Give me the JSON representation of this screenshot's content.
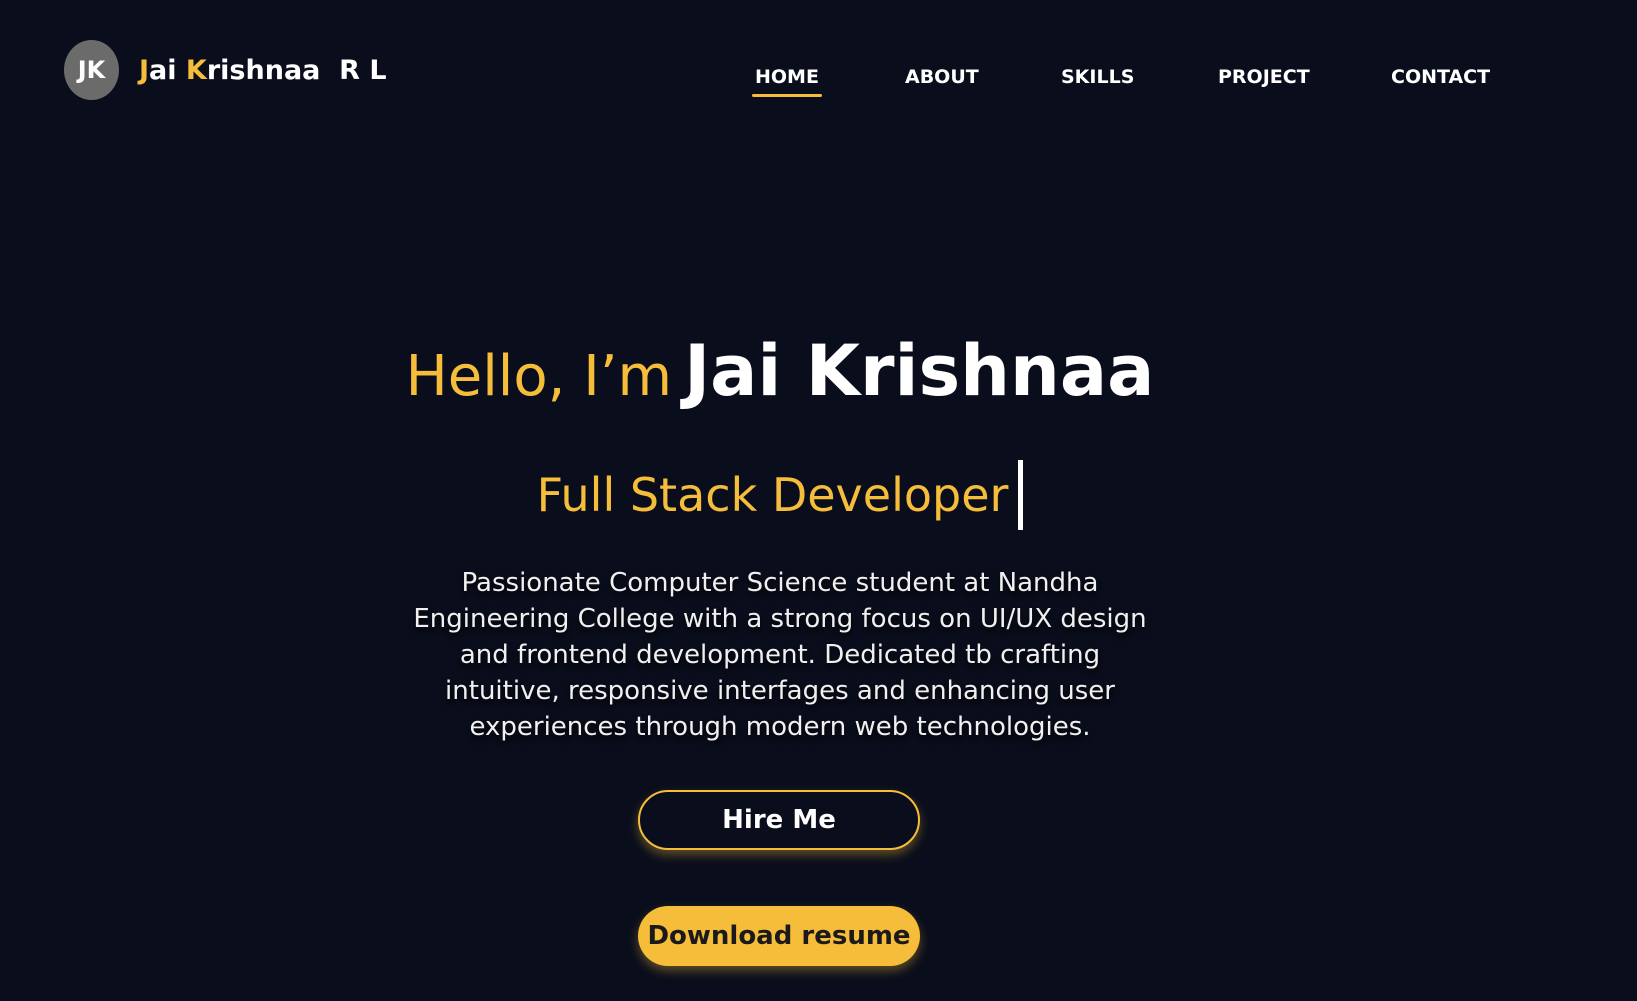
{
  "header": {
    "avatar_initials": "JK",
    "brand": {
      "first_initial": "J",
      "first_rest": "ai ",
      "second_initial": "K",
      "second_rest": "rishnaa  R L"
    },
    "nav": [
      {
        "label": "HOME",
        "active": true
      },
      {
        "label": "ABOUT",
        "active": false
      },
      {
        "label": "SKILLS",
        "active": false
      },
      {
        "label": "PROJECT",
        "active": false
      },
      {
        "label": "CONTACT",
        "active": false
      }
    ]
  },
  "hero": {
    "greeting": "Hello, I’m",
    "name": "Jai Krishnaa",
    "role": "Full Stack Developer",
    "description": "Passionate Computer Science student at Nandha Engineering College  with a strong focus on UI/UX design and frontend development. Dedicated tb crafting intuitive, responsive interfages and enhancing user experiences through modern web technologies.",
    "hire_button": "Hire Me",
    "resume_button": "Download resume"
  },
  "colors": {
    "background": "#0a0e1c",
    "accent": "#f5bd3a",
    "avatar": "#6b6b6b",
    "text": "#ffffff"
  }
}
